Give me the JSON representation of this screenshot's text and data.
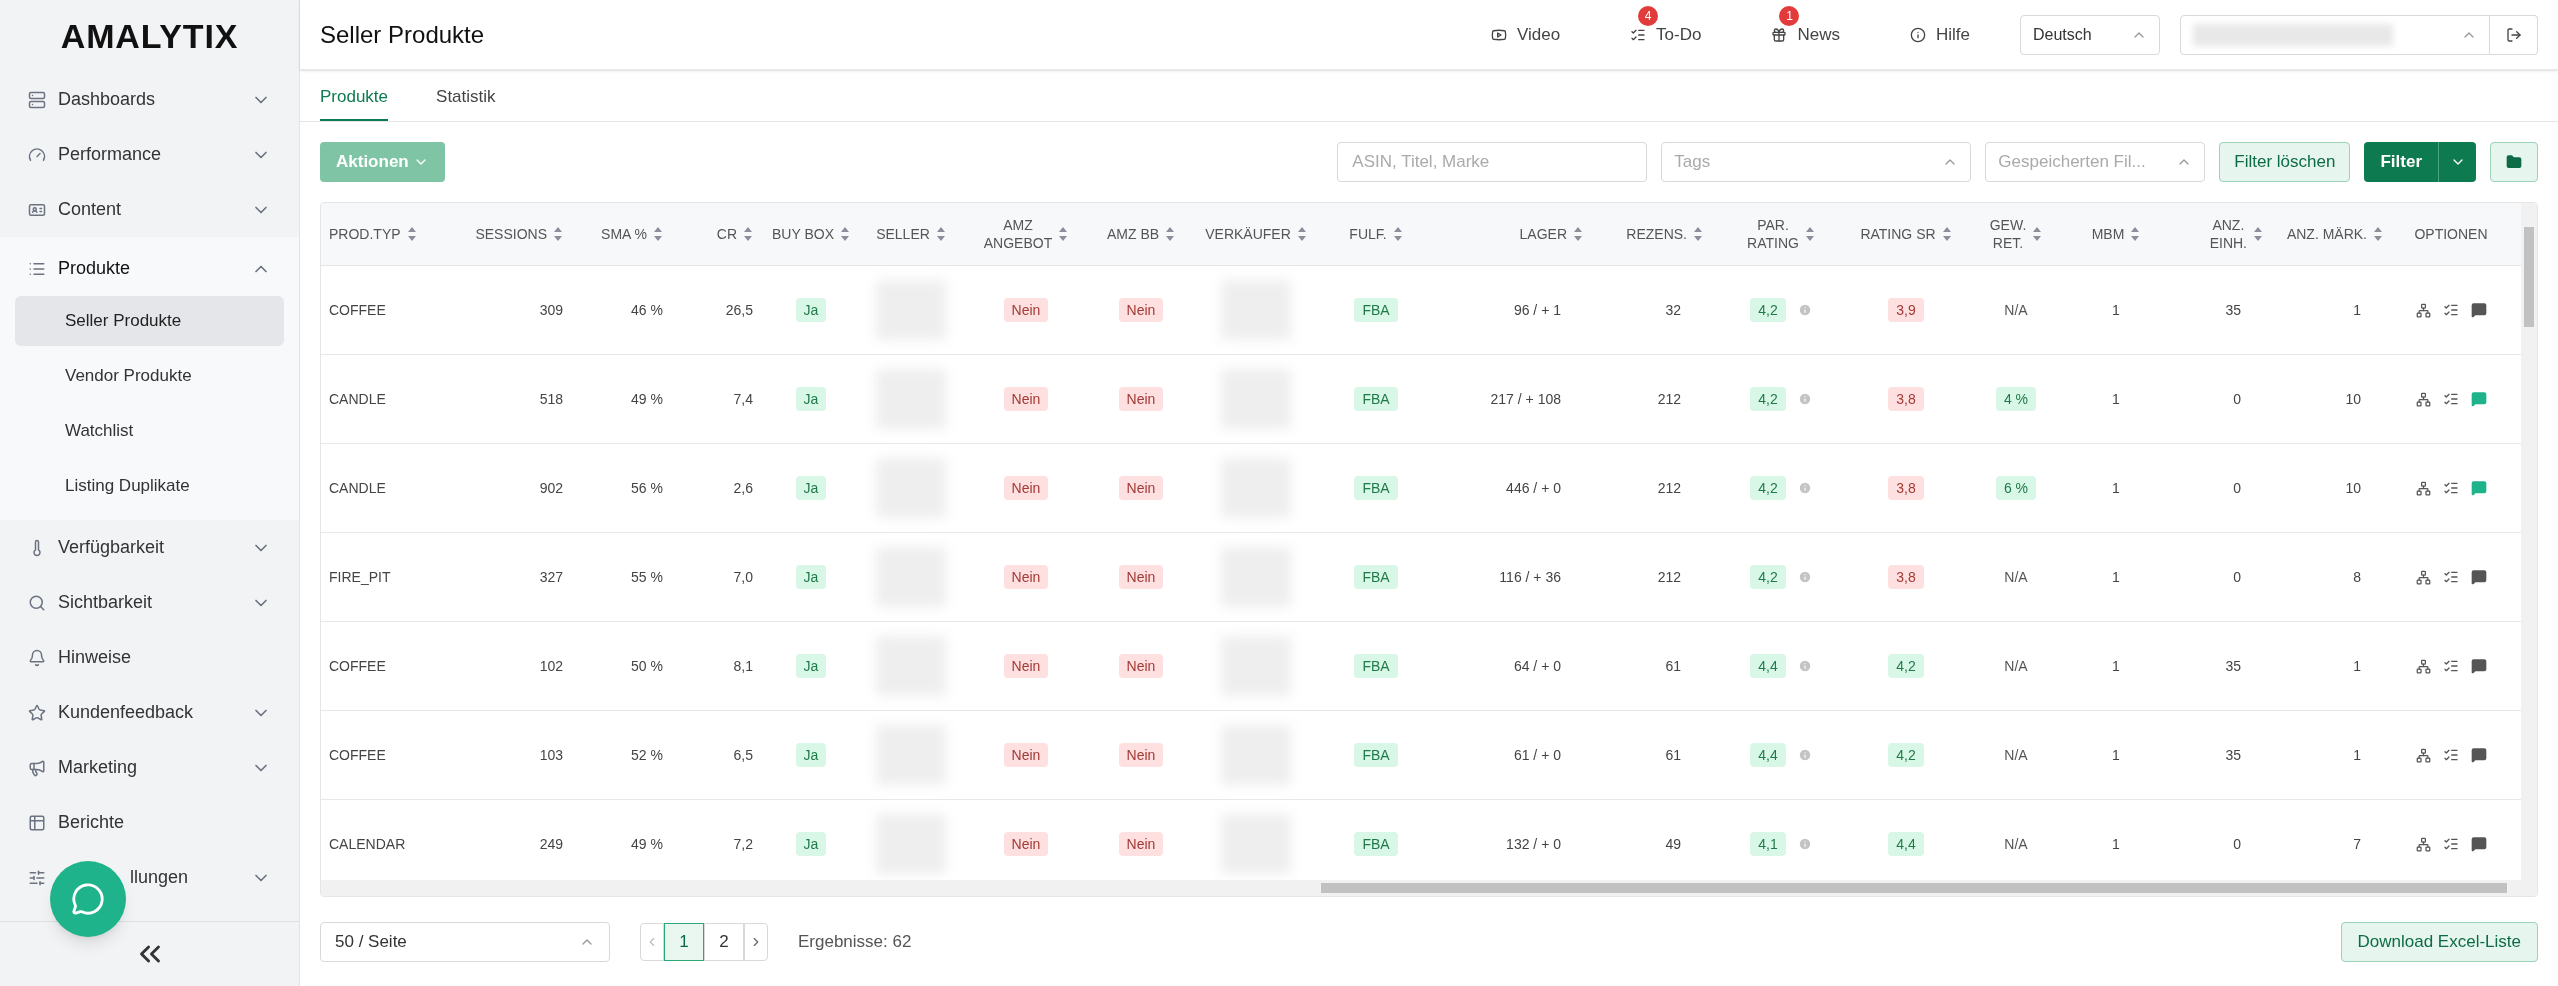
{
  "sidebar": {
    "logo": "AMALYTIX",
    "items": [
      {
        "label": "Dashboards",
        "expandable": true,
        "expanded": false
      },
      {
        "label": "Performance",
        "expandable": true,
        "expanded": false
      },
      {
        "label": "Content",
        "expandable": true,
        "expanded": false
      },
      {
        "label": "Produkte",
        "expandable": true,
        "expanded": true,
        "children": [
          {
            "label": "Seller Produkte",
            "selected": true
          },
          {
            "label": "Vendor Produkte",
            "selected": false
          },
          {
            "label": "Watchlist",
            "selected": false
          },
          {
            "label": "Listing Duplikate",
            "selected": false
          }
        ]
      },
      {
        "label": "Verfügbarkeit",
        "expandable": true,
        "expanded": false
      },
      {
        "label": "Sichtbarkeit",
        "expandable": true,
        "expanded": false
      },
      {
        "label": "Hinweise",
        "expandable": false,
        "expanded": false
      },
      {
        "label": "Kundenfeedback",
        "expandable": true,
        "expanded": false
      },
      {
        "label": "Marketing",
        "expandable": true,
        "expanded": false
      },
      {
        "label": "Berichte",
        "expandable": false,
        "expanded": false
      },
      {
        "label": "llungen",
        "expandable": true,
        "expanded": false
      }
    ]
  },
  "header": {
    "title": "Seller Produkte",
    "links": [
      {
        "label": "Video"
      },
      {
        "label": "To-Do",
        "badge": "4"
      },
      {
        "label": "News",
        "badge": "1"
      },
      {
        "label": "Hilfe"
      }
    ],
    "language": "Deutsch"
  },
  "tabs": [
    {
      "label": "Produkte",
      "selected": true
    },
    {
      "label": "Statistik",
      "selected": false
    }
  ],
  "toolbar": {
    "actions": "Aktionen",
    "search_placeholder": "ASIN, Titel, Marke",
    "tags_placeholder": "Tags",
    "saved_placeholder": "Gespeicherten Fil...",
    "clear": "Filter löschen",
    "filter": "Filter"
  },
  "table": {
    "columns": [
      {
        "label": "PROD.TYP",
        "sortable": true
      },
      {
        "label": "SESSIONS",
        "sortable": true
      },
      {
        "label": "SMA %",
        "sortable": true
      },
      {
        "label": "CR",
        "sortable": true
      },
      {
        "label": "BUY BOX",
        "sortable": true
      },
      {
        "label": "SELLER",
        "sortable": true
      },
      {
        "label": "AMZ\nANGEBOT",
        "sortable": true
      },
      {
        "label": "AMZ BB",
        "sortable": true
      },
      {
        "label": "VERKÄUFER",
        "sortable": true
      },
      {
        "label": "FULF.",
        "sortable": true
      },
      {
        "label": "LAGER",
        "sortable": true
      },
      {
        "label": "REZENS.",
        "sortable": true
      },
      {
        "label": "PAR.\nRATING",
        "sortable": true
      },
      {
        "label": "RATING SR",
        "sortable": true
      },
      {
        "label": "GEW.\nRET.",
        "sortable": true
      },
      {
        "label": "MBM",
        "sortable": true
      },
      {
        "label": "ANZ.\nEINH.",
        "sortable": true
      },
      {
        "label": "ANZ. MÄRK.",
        "sortable": true
      },
      {
        "label": "OPTIONEN",
        "sortable": false
      }
    ],
    "rows": [
      {
        "prod_typ": "COFFEE",
        "sessions": "309",
        "sma": "46 %",
        "cr": "26,5",
        "buy_box": {
          "text": "Ja",
          "kind": "good"
        },
        "amz_angebot": {
          "text": "Nein",
          "kind": "bad"
        },
        "amz_bb": {
          "text": "Nein",
          "kind": "bad"
        },
        "fulf": {
          "text": "FBA",
          "kind": "good"
        },
        "lager": "96 / + 1",
        "rezens": "32",
        "par_rating": {
          "text": "4,2",
          "kind": "good"
        },
        "rating_sr": {
          "text": "3,9",
          "kind": "bad"
        },
        "gew_ret": {
          "text": "N/A",
          "kind": "plain"
        },
        "mbm": "1",
        "anz_einh": "35",
        "anz_maerk": "1",
        "comment_active": false
      },
      {
        "prod_typ": "CANDLE",
        "sessions": "518",
        "sma": "49 %",
        "cr": "7,4",
        "buy_box": {
          "text": "Ja",
          "kind": "good"
        },
        "amz_angebot": {
          "text": "Nein",
          "kind": "bad"
        },
        "amz_bb": {
          "text": "Nein",
          "kind": "bad"
        },
        "fulf": {
          "text": "FBA",
          "kind": "good"
        },
        "lager": "217 / + 108",
        "rezens": "212",
        "par_rating": {
          "text": "4,2",
          "kind": "good"
        },
        "rating_sr": {
          "text": "3,8",
          "kind": "bad"
        },
        "gew_ret": {
          "text": "4 %",
          "kind": "good"
        },
        "mbm": "1",
        "anz_einh": "0",
        "anz_maerk": "10",
        "comment_active": true
      },
      {
        "prod_typ": "CANDLE",
        "sessions": "902",
        "sma": "56 %",
        "cr": "2,6",
        "buy_box": {
          "text": "Ja",
          "kind": "good"
        },
        "amz_angebot": {
          "text": "Nein",
          "kind": "bad"
        },
        "amz_bb": {
          "text": "Nein",
          "kind": "bad"
        },
        "fulf": {
          "text": "FBA",
          "kind": "good"
        },
        "lager": "446 / + 0",
        "rezens": "212",
        "par_rating": {
          "text": "4,2",
          "kind": "good"
        },
        "rating_sr": {
          "text": "3,8",
          "kind": "bad"
        },
        "gew_ret": {
          "text": "6 %",
          "kind": "good"
        },
        "mbm": "1",
        "anz_einh": "0",
        "anz_maerk": "10",
        "comment_active": true
      },
      {
        "prod_typ": "FIRE_PIT",
        "sessions": "327",
        "sma": "55 %",
        "cr": "7,0",
        "buy_box": {
          "text": "Ja",
          "kind": "good"
        },
        "amz_angebot": {
          "text": "Nein",
          "kind": "bad"
        },
        "amz_bb": {
          "text": "Nein",
          "kind": "bad"
        },
        "fulf": {
          "text": "FBA",
          "kind": "good"
        },
        "lager": "116 / + 36",
        "rezens": "212",
        "par_rating": {
          "text": "4,2",
          "kind": "good"
        },
        "rating_sr": {
          "text": "3,8",
          "kind": "bad"
        },
        "gew_ret": {
          "text": "N/A",
          "kind": "plain"
        },
        "mbm": "1",
        "anz_einh": "0",
        "anz_maerk": "8",
        "comment_active": false
      },
      {
        "prod_typ": "COFFEE",
        "sessions": "102",
        "sma": "50 %",
        "cr": "8,1",
        "buy_box": {
          "text": "Ja",
          "kind": "good"
        },
        "amz_angebot": {
          "text": "Nein",
          "kind": "bad"
        },
        "amz_bb": {
          "text": "Nein",
          "kind": "bad"
        },
        "fulf": {
          "text": "FBA",
          "kind": "good"
        },
        "lager": "64 / + 0",
        "rezens": "61",
        "par_rating": {
          "text": "4,4",
          "kind": "good"
        },
        "rating_sr": {
          "text": "4,2",
          "kind": "good"
        },
        "gew_ret": {
          "text": "N/A",
          "kind": "plain"
        },
        "mbm": "1",
        "anz_einh": "35",
        "anz_maerk": "1",
        "comment_active": false
      },
      {
        "prod_typ": "COFFEE",
        "sessions": "103",
        "sma": "52 %",
        "cr": "6,5",
        "buy_box": {
          "text": "Ja",
          "kind": "good"
        },
        "amz_angebot": {
          "text": "Nein",
          "kind": "bad"
        },
        "amz_bb": {
          "text": "Nein",
          "kind": "bad"
        },
        "fulf": {
          "text": "FBA",
          "kind": "good"
        },
        "lager": "61 / + 0",
        "rezens": "61",
        "par_rating": {
          "text": "4,4",
          "kind": "good"
        },
        "rating_sr": {
          "text": "4,2",
          "kind": "good"
        },
        "gew_ret": {
          "text": "N/A",
          "kind": "plain"
        },
        "mbm": "1",
        "anz_einh": "35",
        "anz_maerk": "1",
        "comment_active": false
      },
      {
        "prod_typ": "CALENDAR",
        "sessions": "249",
        "sma": "49 %",
        "cr": "7,2",
        "buy_box": {
          "text": "Ja",
          "kind": "good"
        },
        "amz_angebot": {
          "text": "Nein",
          "kind": "bad"
        },
        "amz_bb": {
          "text": "Nein",
          "kind": "bad"
        },
        "fulf": {
          "text": "FBA",
          "kind": "good"
        },
        "lager": "132 / + 0",
        "rezens": "49",
        "par_rating": {
          "text": "4,1",
          "kind": "good"
        },
        "rating_sr": {
          "text": "4,4",
          "kind": "good"
        },
        "gew_ret": {
          "text": "N/A",
          "kind": "plain"
        },
        "mbm": "1",
        "anz_einh": "0",
        "anz_maerk": "7",
        "comment_active": false
      }
    ]
  },
  "footer": {
    "page_size": "50 / Seite",
    "pages": [
      {
        "label": "1",
        "selected": true
      },
      {
        "label": "2",
        "selected": false
      }
    ],
    "results": "Ergebnisse: 62",
    "download": "Download Excel-Liste"
  }
}
